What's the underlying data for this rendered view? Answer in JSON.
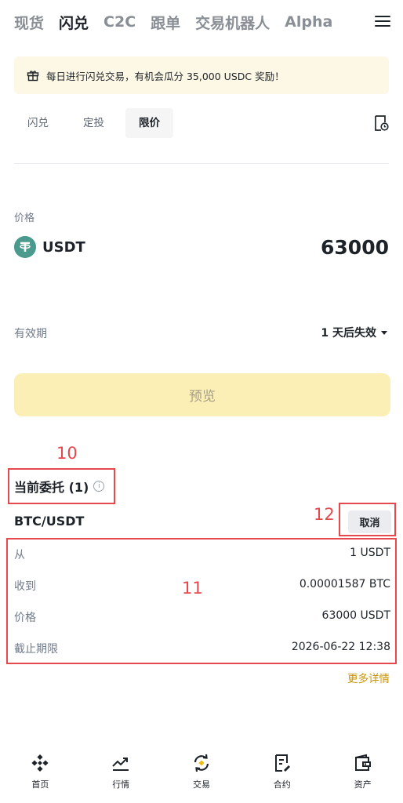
{
  "topnav": {
    "tabs": [
      "现货",
      "闪兑",
      "C2C",
      "跟单",
      "交易机器人",
      "Alpha"
    ],
    "active": "闪兑"
  },
  "banner": {
    "text": "每日进行闪兑交易，有机会瓜分 35,000 USDC 奖励！"
  },
  "subtabs": [
    "闪兑",
    "定投",
    "限价"
  ],
  "form": {
    "price_label": "价格",
    "coin": "USDT",
    "price": "63000",
    "validity_label": "有效期",
    "validity_value": "1 天后失效",
    "preview_label": "预览"
  },
  "annotations": [
    "10",
    "11",
    "12"
  ],
  "orders": {
    "title": "当前委托 (1)",
    "info_glyph": "i",
    "pair": "BTC/USDT",
    "cancel_label": "取消",
    "rows": [
      {
        "key": "从",
        "value": "1 USDT"
      },
      {
        "key": "收到",
        "value": "0.00001587 BTC"
      },
      {
        "key": "价格",
        "value": "63000 USDT"
      },
      {
        "key": "截止期限",
        "value": "2026-06-22 12:38"
      }
    ],
    "more_label": "更多详情"
  },
  "bottom_nav": [
    {
      "label": "首页",
      "icon": "binance-logo-icon"
    },
    {
      "label": "行情",
      "icon": "market-chart-icon"
    },
    {
      "label": "交易",
      "icon": "trade-swap-icon"
    },
    {
      "label": "合约",
      "icon": "futures-doc-icon"
    },
    {
      "label": "资产",
      "icon": "wallet-icon"
    }
  ],
  "colors": {
    "accent": "#c99400",
    "preview_bg": "#fcefb6",
    "banner_bg": "#fdf8e5",
    "annotation_red": "#e5484d",
    "usdt_green": "#4a9b8e"
  }
}
